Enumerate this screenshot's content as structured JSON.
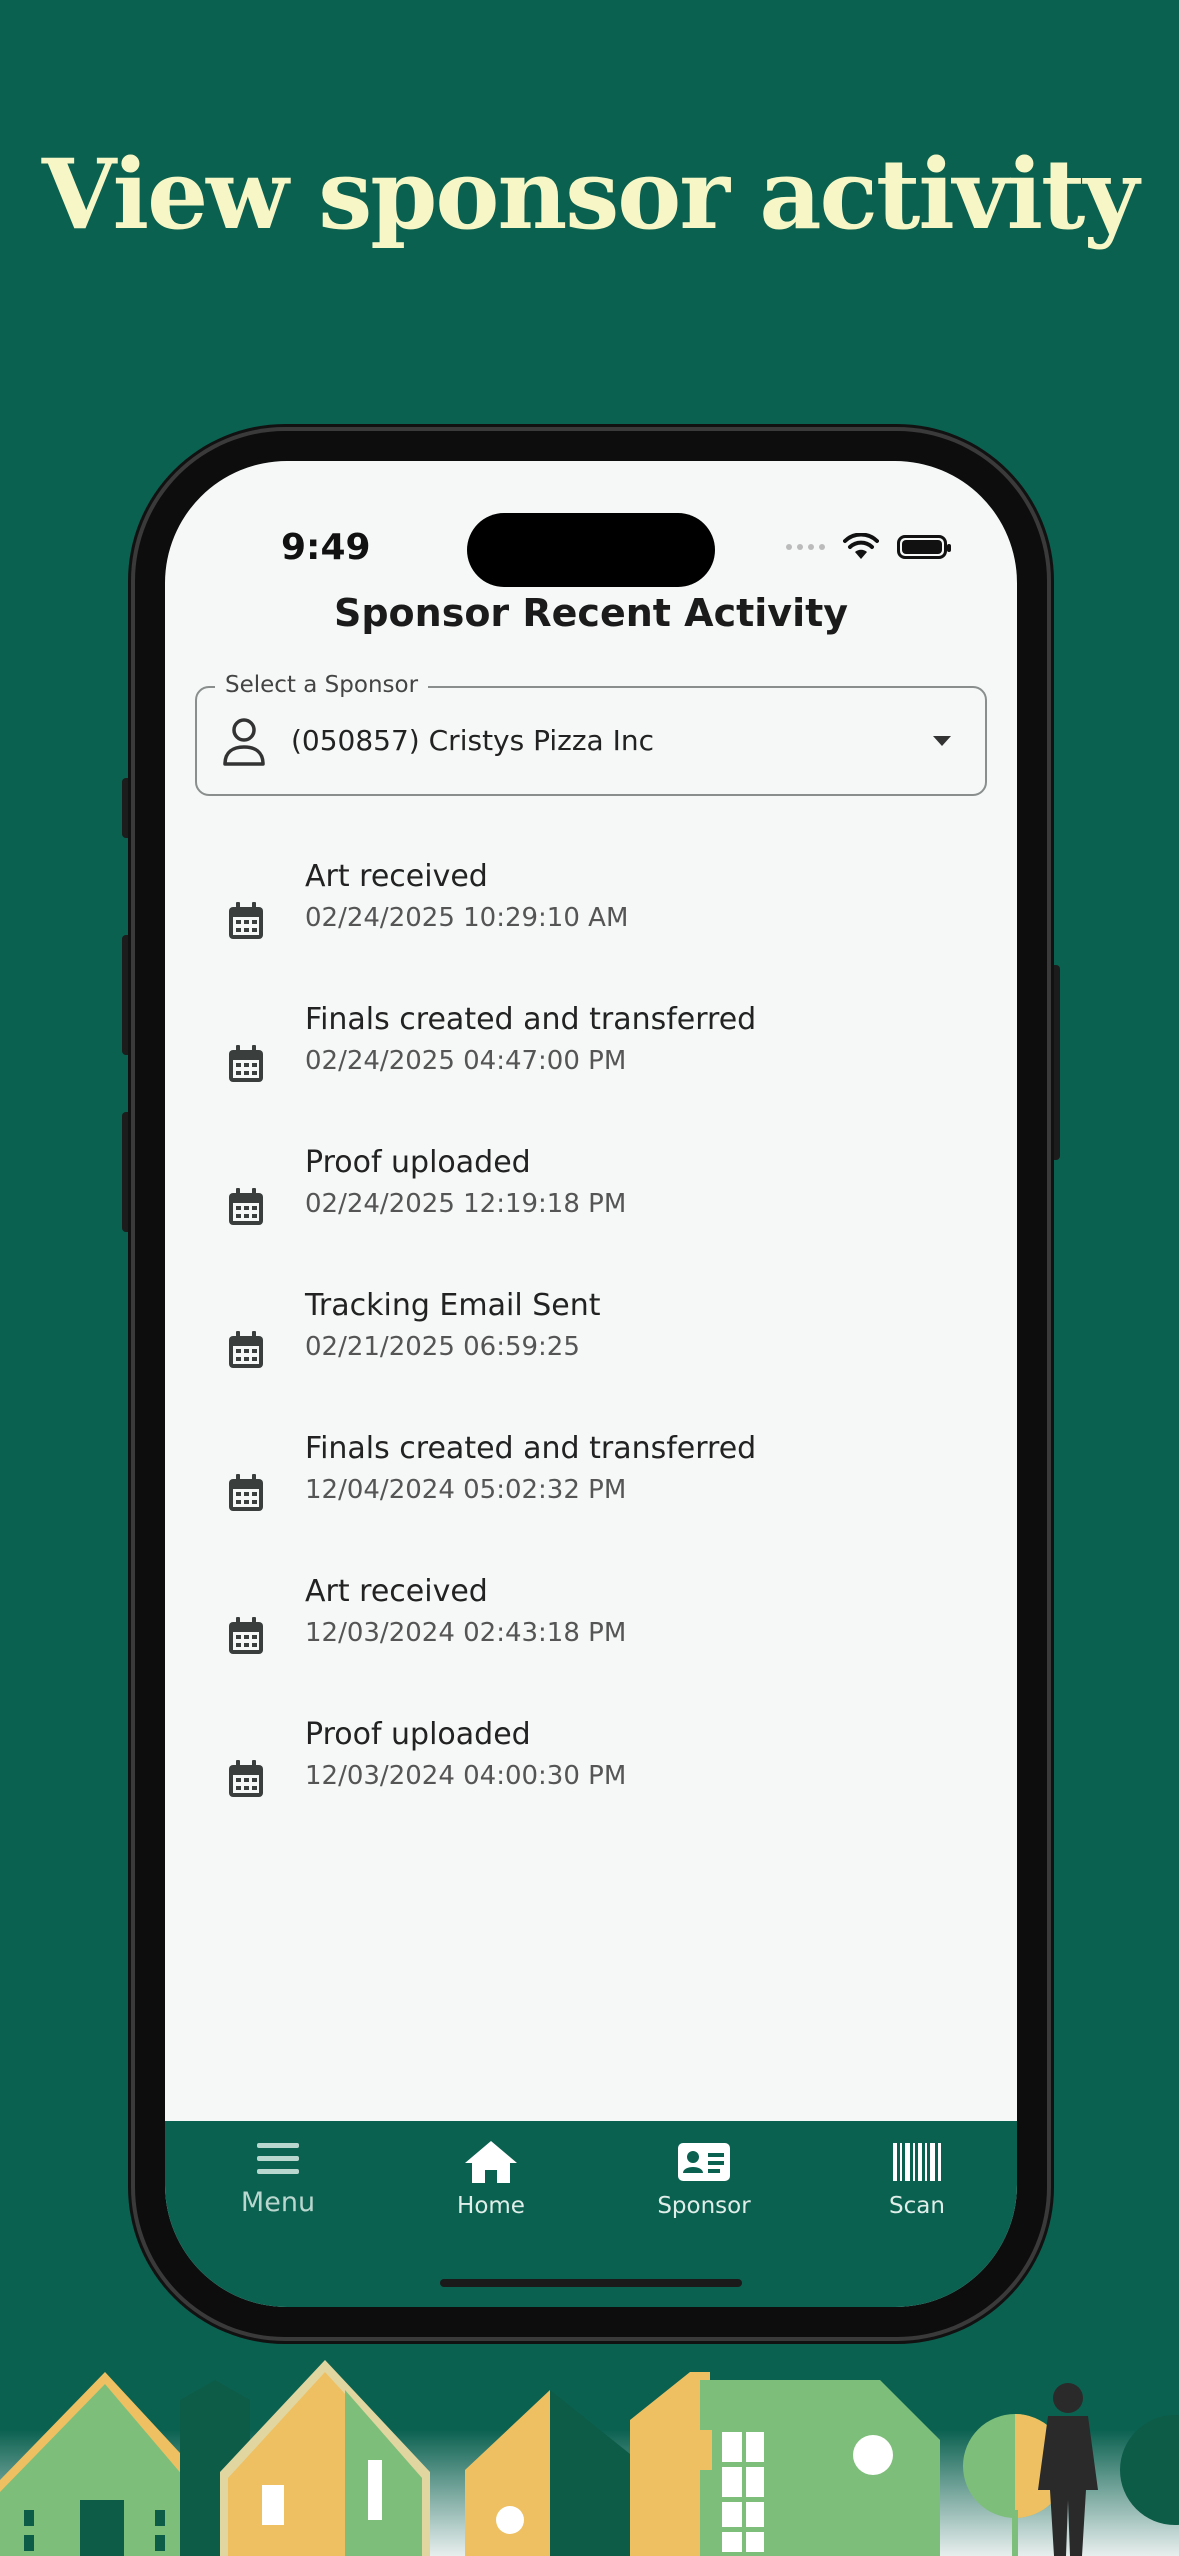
{
  "headline": "View sponsor activity",
  "status_bar": {
    "time": "9:49"
  },
  "page": {
    "title": "Sponsor Recent Activity",
    "select": {
      "label": "Select a Sponsor",
      "value": "(050857) Cristys Pizza Inc"
    }
  },
  "activity": [
    {
      "title": "Art received",
      "timestamp": "02/24/2025 10:29:10 AM"
    },
    {
      "title": "Finals created and transferred",
      "timestamp": "02/24/2025 04:47:00 PM"
    },
    {
      "title": "Proof uploaded",
      "timestamp": "02/24/2025 12:19:18 PM"
    },
    {
      "title": "Tracking Email Sent",
      "timestamp": "02/21/2025 06:59:25"
    },
    {
      "title": "Finals created and transferred",
      "timestamp": "12/04/2024 05:02:32 PM"
    },
    {
      "title": "Art received",
      "timestamp": "12/03/2024 02:43:18 PM"
    },
    {
      "title": "Proof uploaded",
      "timestamp": "12/03/2024 04:00:30 PM"
    }
  ],
  "tabs": [
    {
      "label": "Menu",
      "icon": "menu-icon"
    },
    {
      "label": "Home",
      "icon": "home-icon"
    },
    {
      "label": "Sponsor",
      "icon": "id-card-icon"
    },
    {
      "label": "Scan",
      "icon": "barcode-icon"
    }
  ],
  "colors": {
    "background": "#0b6150",
    "headline": "#f7f6c6",
    "screen": "#f5f8f7",
    "house_green": "#7dbf7a",
    "house_yellow": "#eec062",
    "house_dark": "#0d5c48"
  }
}
